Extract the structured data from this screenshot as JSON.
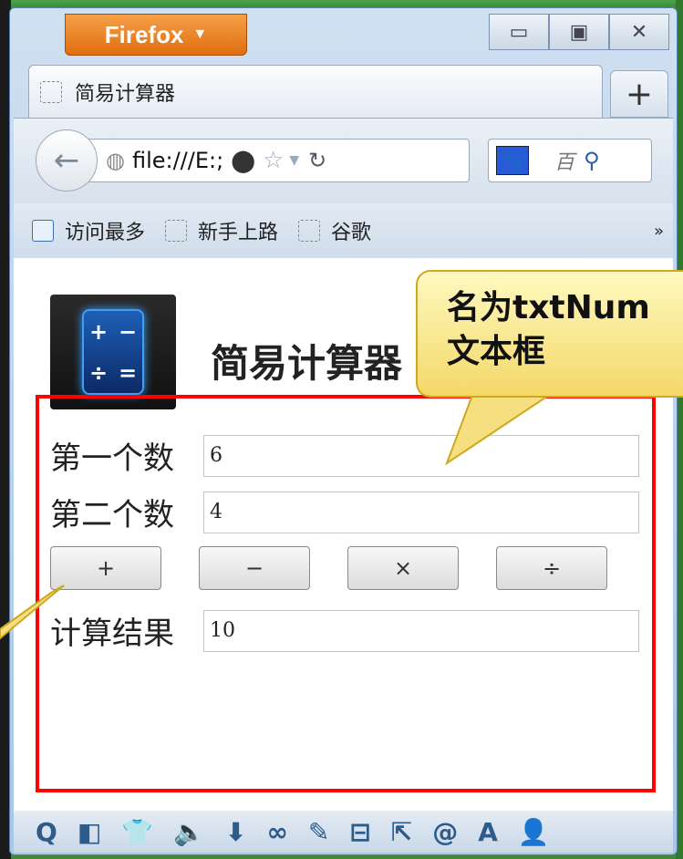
{
  "browser": {
    "menu_button": "Firefox",
    "menu_arrow": "▼",
    "win_minimize": "▭",
    "win_maximize": "▣",
    "win_close": "✕",
    "tab_title": "简易计算器",
    "new_tab": "+",
    "back": "←",
    "url": "file:///E:;",
    "search_placeholder": "百",
    "search_engine": "🐾",
    "bookmarks": [
      "访问最多",
      "新手上路",
      "谷歌"
    ],
    "bookmarks_more": "»"
  },
  "page": {
    "title": "简易计算器",
    "icon_glyphs": [
      "+",
      "−",
      "÷",
      "="
    ],
    "first_label": "第一个数",
    "first_value": "6",
    "second_label": "第二个数",
    "second_value": "4",
    "op_buttons": [
      "+",
      "−",
      "×",
      "÷"
    ],
    "result_label": "计算结果",
    "result_value": "10"
  },
  "callout": {
    "line1": "名为txtNum",
    "line2": "文本框"
  },
  "statusbar_icons": [
    "Q",
    "◧",
    "👕",
    "🔈",
    "⬇",
    "∞",
    "✎",
    "⊟",
    "⇱",
    "@",
    "A",
    "👤"
  ]
}
